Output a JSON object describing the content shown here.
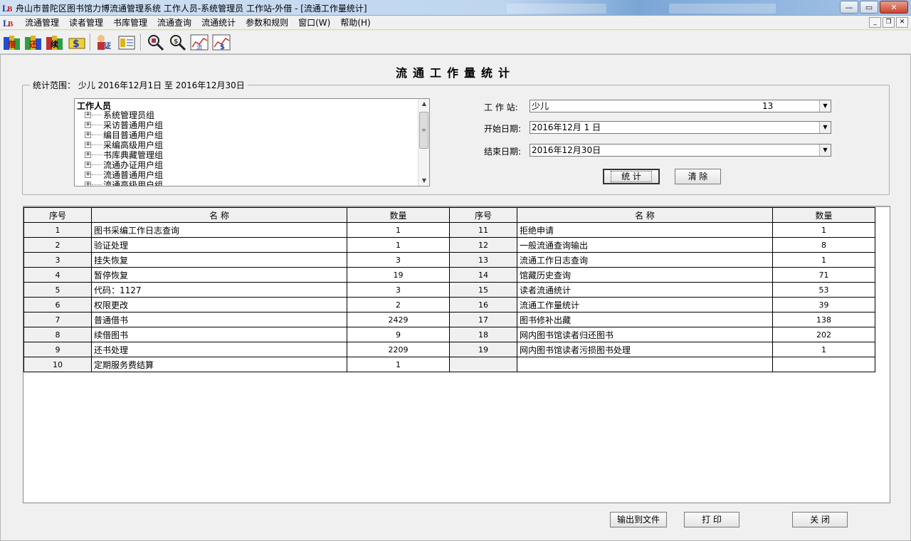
{
  "window": {
    "title": "舟山市普陀区图书馆力博流通管理系统 工作人员-系统管理员 工作站-外借 - [流通工作量统计]",
    "min_symbol": "—",
    "max_symbol": "▭",
    "close_symbol": "✕"
  },
  "menu": {
    "items": [
      "流通管理",
      "读者管理",
      "书库管理",
      "流通查询",
      "流通统计",
      "参数和规则",
      "窗口(W)",
      "帮助(H)"
    ],
    "mdi_min": "_",
    "mdi_restore": "❐",
    "mdi_close": "✕"
  },
  "toolbar": {
    "icons": [
      "borrow-book-icon",
      "return-book-icon",
      "renew-book-icon",
      "fine-payment-icon",
      "reader-register-icon",
      "reader-card-icon",
      "search-book-icon",
      "search-reader-icon",
      "circulation-stats-icon",
      "finance-stats-icon"
    ]
  },
  "page": {
    "title": "流通工作量统计"
  },
  "range": {
    "legend": "统计范围：  少儿  2016年12月1日  至  2016年12月30日"
  },
  "tree": {
    "root": "工作人员",
    "nodes": [
      "系统管理员组",
      "采访普通用户组",
      "编目普通用户组",
      "采编高级用户组",
      "书库典藏管理组",
      "流通办证用户组",
      "流通普通用户组",
      "流通高级用户组"
    ]
  },
  "form": {
    "workstation_label": "工 作 站:",
    "workstation_value": "少儿",
    "workstation_code": "13",
    "start_label": "开始日期:",
    "start_value": "2016年12月 1 日",
    "end_label": "结束日期:",
    "end_value": "2016年12月30日",
    "stat_button": "统 计",
    "clear_button": "清 除"
  },
  "grid": {
    "headers": {
      "index": "序号",
      "name": "名    称",
      "qty": "数量"
    },
    "rows": [
      {
        "l_idx": "1",
        "l_name": "图书采编工作日志查询",
        "l_qty": "1",
        "r_idx": "11",
        "r_name": "拒绝申请",
        "r_qty": "1"
      },
      {
        "l_idx": "2",
        "l_name": "验证处理",
        "l_qty": "1",
        "r_idx": "12",
        "r_name": "一般流通查询输出",
        "r_qty": "8"
      },
      {
        "l_idx": "3",
        "l_name": "挂失恢复",
        "l_qty": "3",
        "r_idx": "13",
        "r_name": "流通工作日志查询",
        "r_qty": "1"
      },
      {
        "l_idx": "4",
        "l_name": "暂停恢复",
        "l_qty": "19",
        "r_idx": "14",
        "r_name": "馆藏历史查询",
        "r_qty": "71"
      },
      {
        "l_idx": "5",
        "l_name": "代码：1127",
        "l_qty": "3",
        "r_idx": "15",
        "r_name": "读者流通统计",
        "r_qty": "53"
      },
      {
        "l_idx": "6",
        "l_name": "权限更改",
        "l_qty": "2",
        "r_idx": "16",
        "r_name": "流通工作量统计",
        "r_qty": "39"
      },
      {
        "l_idx": "7",
        "l_name": "普通借书",
        "l_qty": "2429",
        "r_idx": "17",
        "r_name": "图书修补出藏",
        "r_qty": "138"
      },
      {
        "l_idx": "8",
        "l_name": "续借图书",
        "l_qty": "9",
        "r_idx": "18",
        "r_name": "网内图书馆读者归还图书",
        "r_qty": "202"
      },
      {
        "l_idx": "9",
        "l_name": "还书处理",
        "l_qty": "2209",
        "r_idx": "19",
        "r_name": "网内图书馆读者污损图书处理",
        "r_qty": "1"
      },
      {
        "l_idx": "10",
        "l_name": "定期服务费结算",
        "l_qty": "1",
        "r_idx": "",
        "r_name": "",
        "r_qty": ""
      }
    ]
  },
  "footer": {
    "export_button": "输出到文件",
    "print_button": "打 印",
    "close_button": "关 闭"
  }
}
